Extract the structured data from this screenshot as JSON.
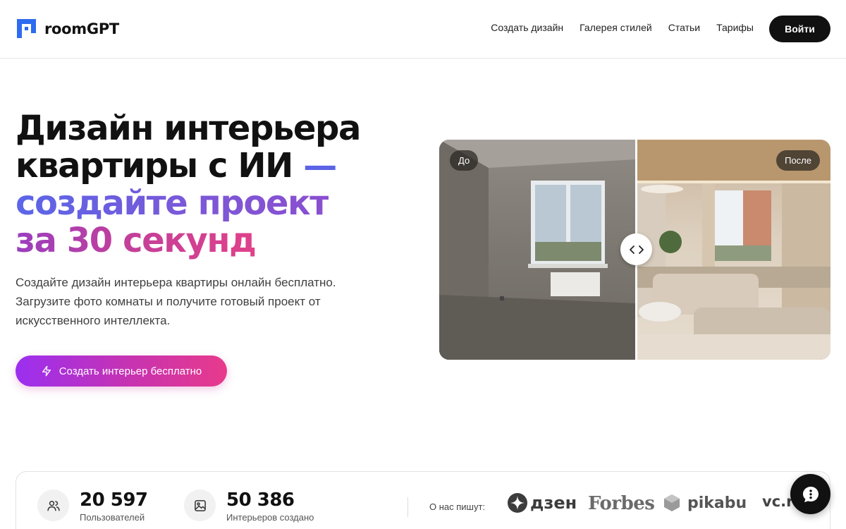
{
  "header": {
    "brand": "roomGPT",
    "nav": [
      {
        "label": "Создать дизайн"
      },
      {
        "label": "Галерея стилей"
      },
      {
        "label": "Статьи"
      },
      {
        "label": "Тарифы"
      }
    ],
    "login_label": "Войти"
  },
  "hero": {
    "title_line1": "Дизайн интерьера",
    "title_line2": "квартиры с ИИ",
    "title_dash": "—",
    "title_line3": "создайте проект",
    "title_line4": "за 30 секунд",
    "subtitle": "Создайте дизайн интерьера квартиры онлайн бесплатно. Загрузите фото комнаты и получите готовый проект от искусственного интеллекта.",
    "cta_label": "Создать интерьер бесплатно",
    "cta_icon": "lightning-icon"
  },
  "compare": {
    "before_label": "До",
    "after_label": "После",
    "handle_icon": "arrows-left-right-icon",
    "split_fraction": 0.5
  },
  "stats": {
    "items": [
      {
        "value": "20 597",
        "label": "Пользователей",
        "icon": "users-icon"
      },
      {
        "value": "50 386",
        "label": "Интерьеров создано",
        "icon": "image-icon"
      }
    ],
    "press_label": "О нас пишут:",
    "press": [
      {
        "name": "дзен"
      },
      {
        "name": "Forbes"
      },
      {
        "name": "pikabu"
      },
      {
        "name": "vc.ru"
      }
    ]
  },
  "chat": {
    "icon": "chat-dots-icon"
  },
  "colors": {
    "accent_blue": "#5b63e6",
    "accent_purple": "#9b2ff0",
    "accent_pink": "#e83a8c",
    "dark": "#111111"
  }
}
